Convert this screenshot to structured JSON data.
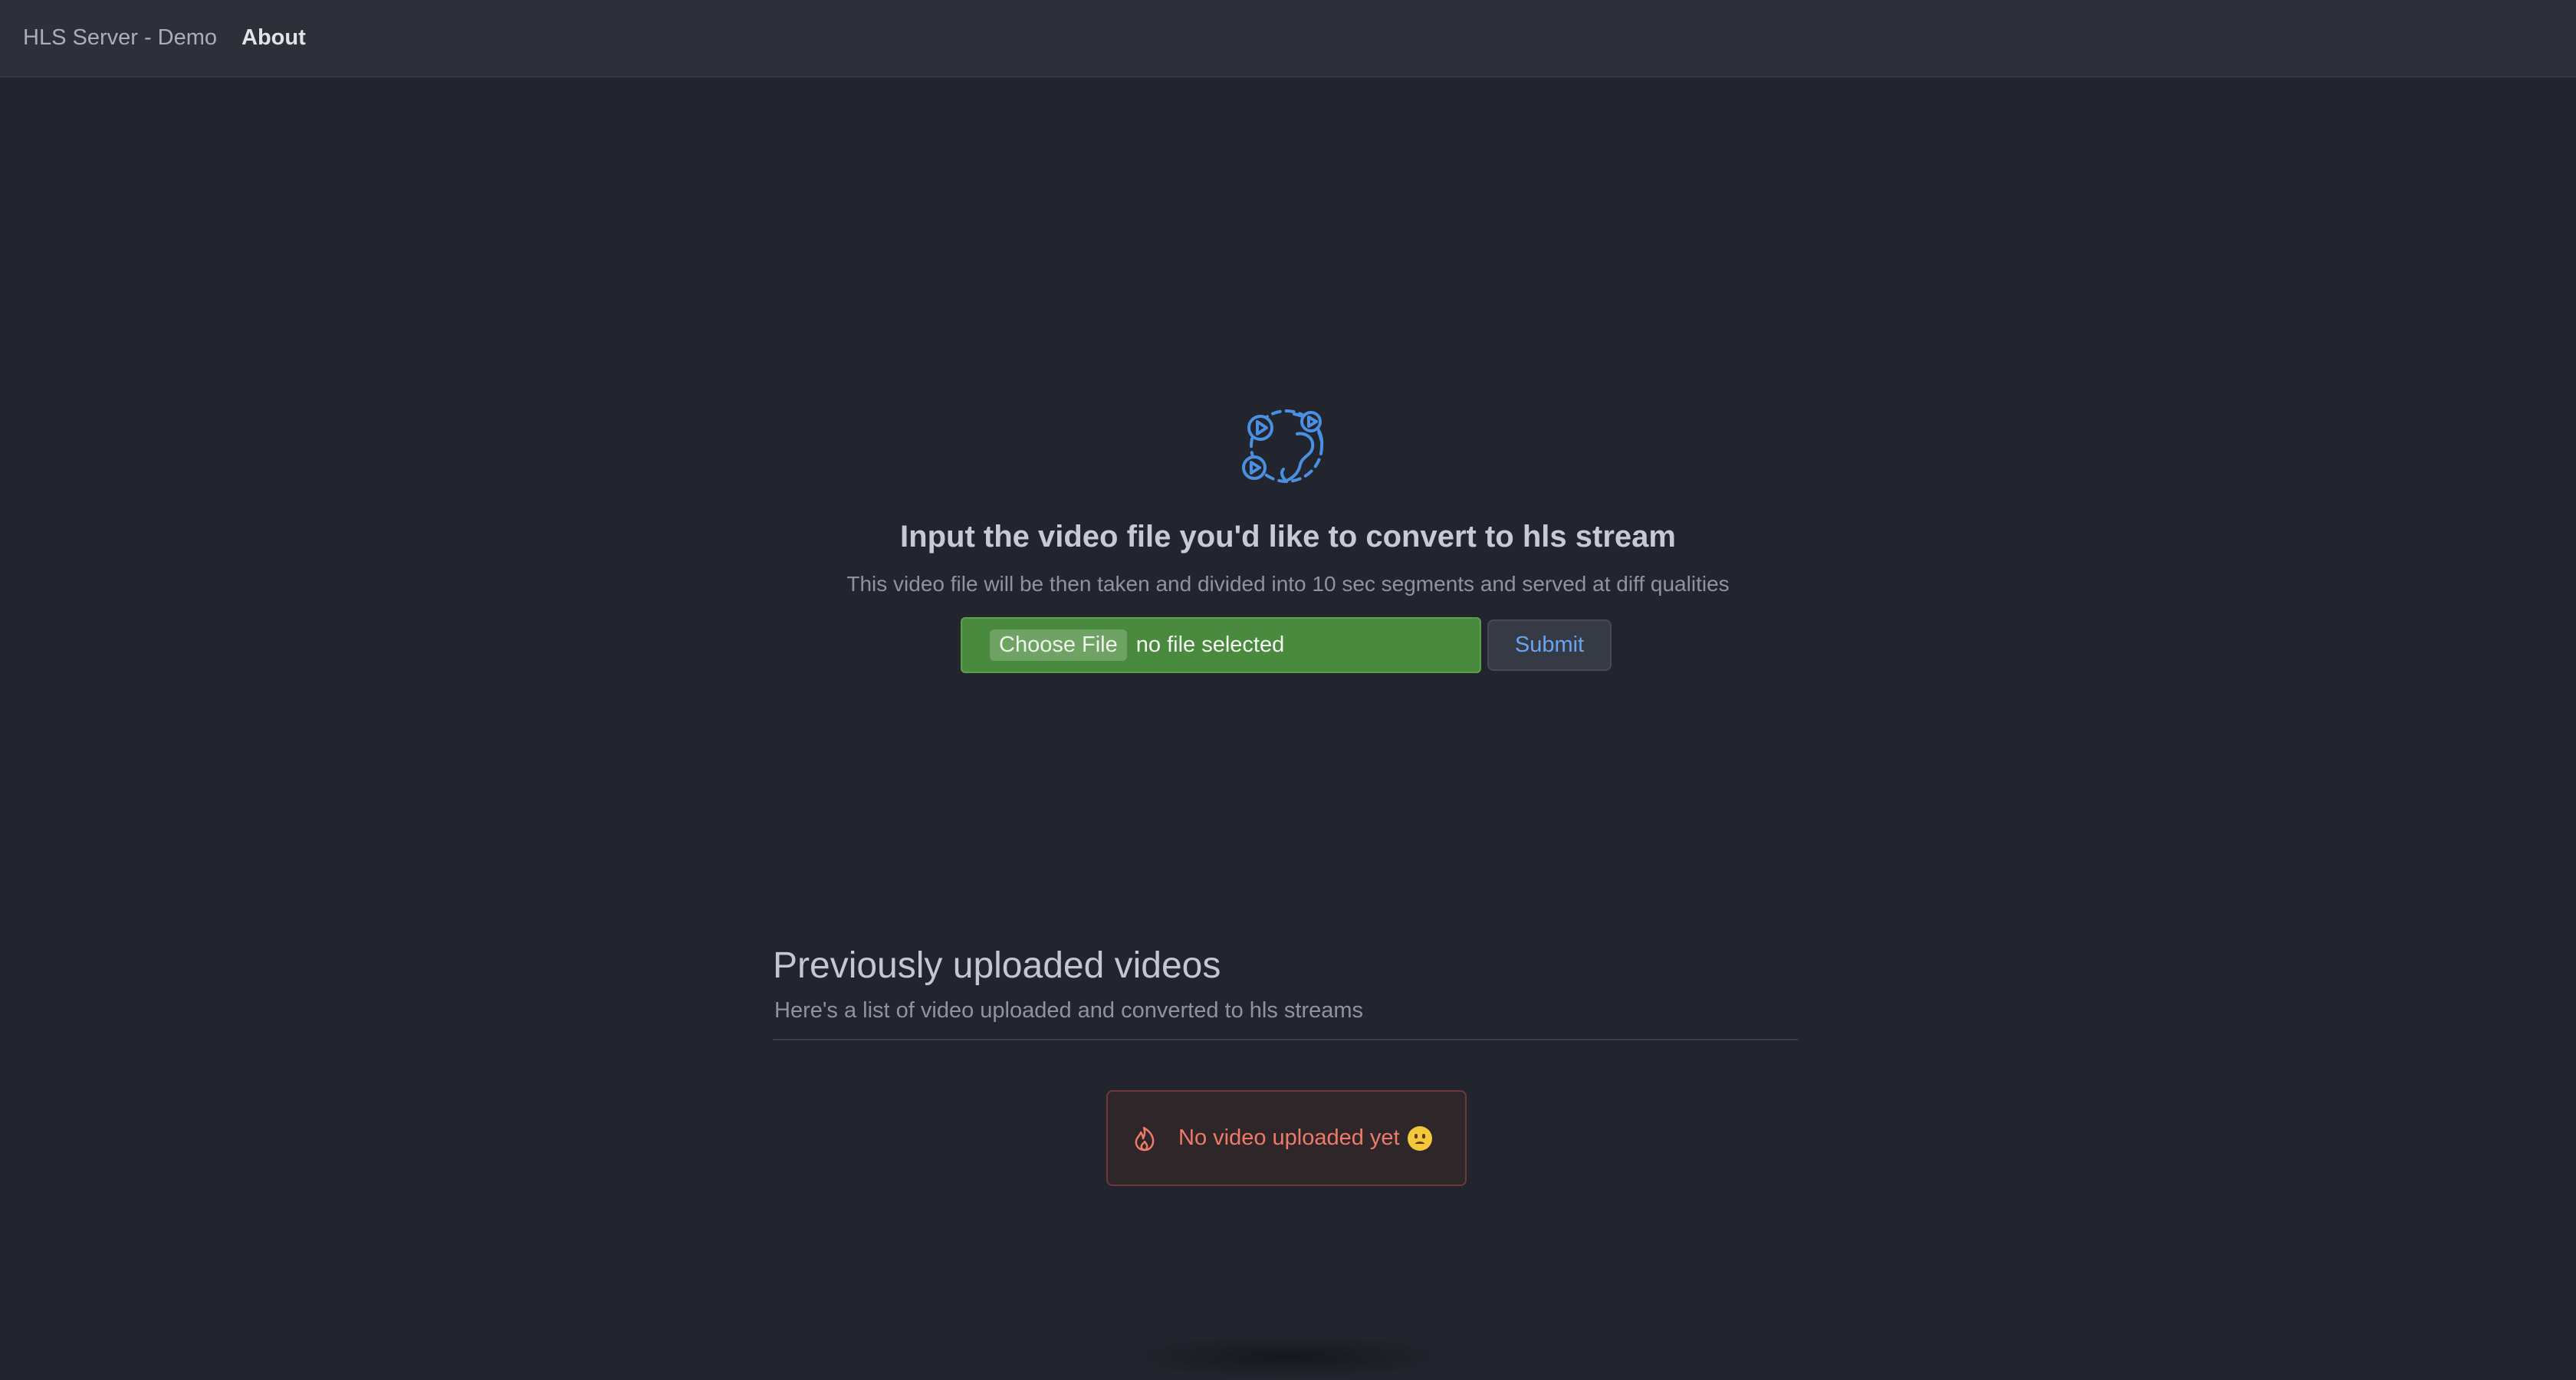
{
  "nav": {
    "brand": "HLS Server - Demo",
    "about": "About"
  },
  "hero": {
    "icon": "globe-video-icon",
    "title": "Input the video file you'd like to convert to hls stream",
    "subtitle": "This video file will be then taken and divided into 10 sec segments and served at diff qualities"
  },
  "upload": {
    "choose_label": "Choose File",
    "status": "no file selected",
    "submit_label": "Submit"
  },
  "videos": {
    "title": "Previously uploaded videos",
    "subtitle": "Here's a list of video uploaded and converted to hls streams",
    "empty_icon": "flame-icon",
    "empty_message": "No video uploaded yet",
    "empty_emoji": "sad-face-emoji"
  },
  "colors": {
    "background": "#22252e",
    "navbar": "#2d3039",
    "accent_blue": "#4a90e2",
    "file_input_green": "#4a8a3e",
    "alert_red": "#ee7a68"
  }
}
